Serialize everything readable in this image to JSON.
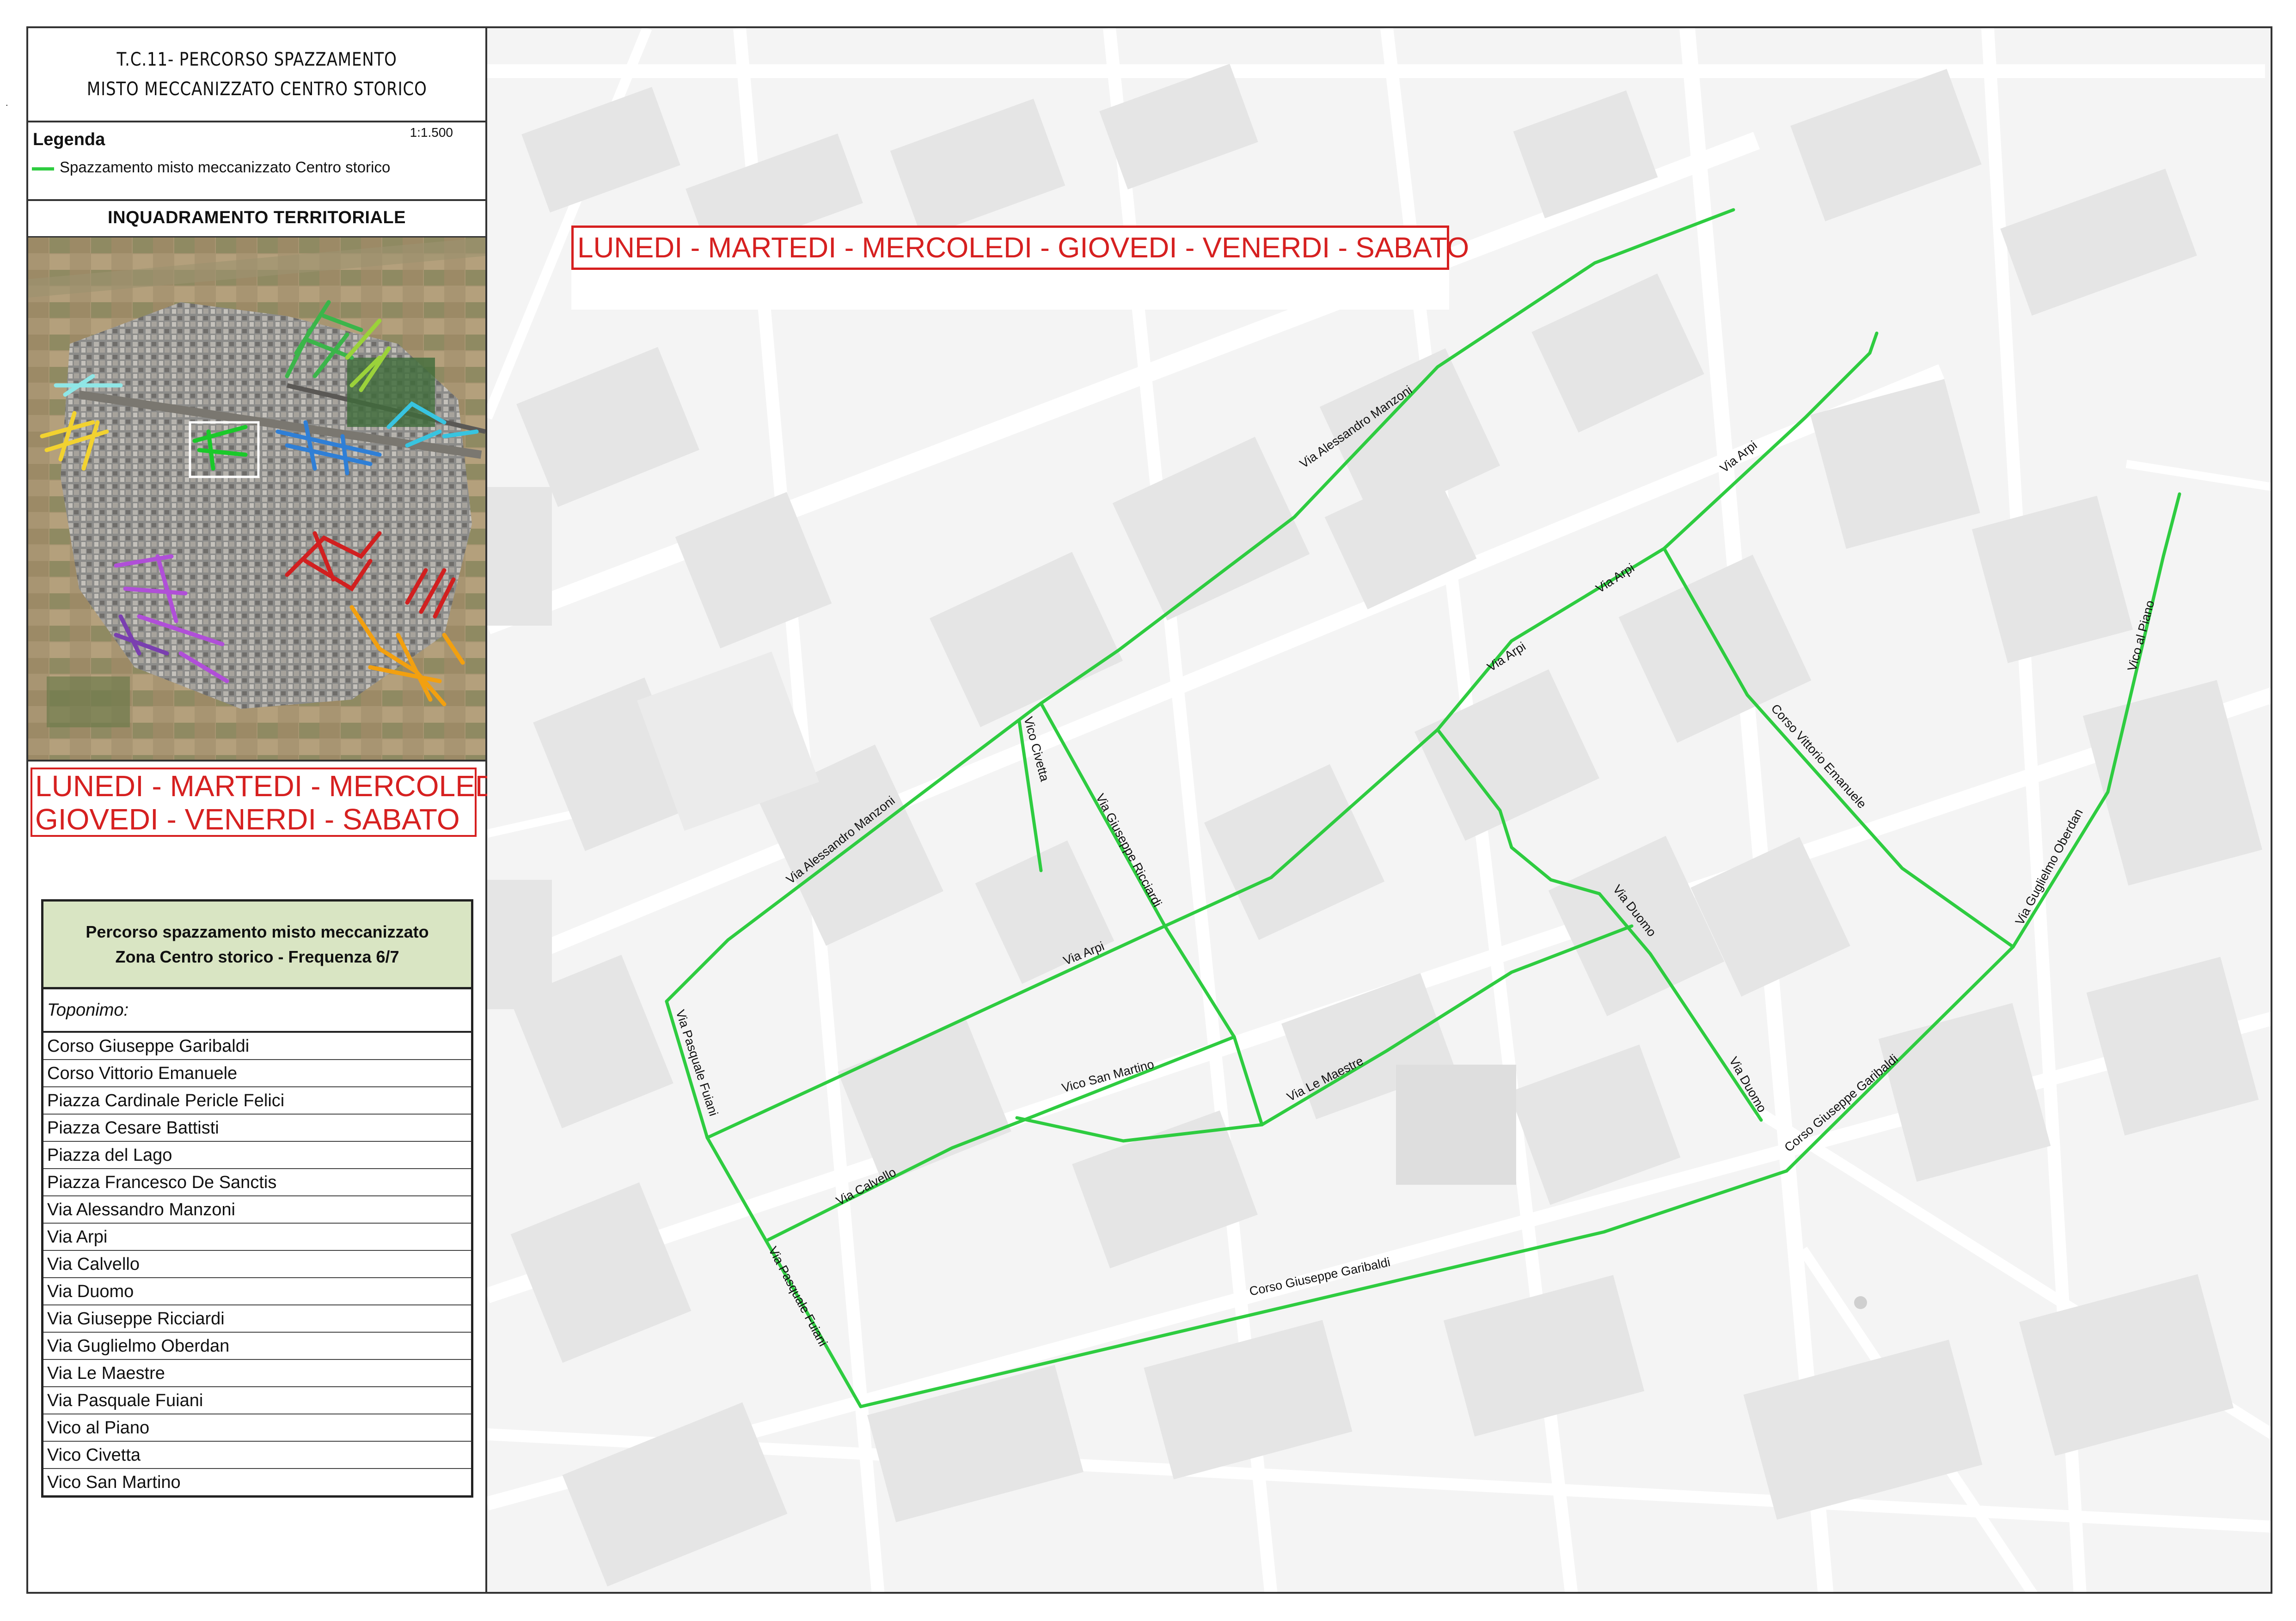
{
  "header": {
    "title_line1": "T.C.11- PERCORSO SPAZZAMENTO",
    "title_line2": "MISTO MECCANIZZATO CENTRO STORICO"
  },
  "legend": {
    "title": "Legenda",
    "scale": "1:1.500",
    "item_label": "Spazzamento misto meccanizzato Centro storico",
    "route_color": "#2ecc40"
  },
  "overview": {
    "title": "INQUADRAMENTO TERRITORIALE"
  },
  "days_left": {
    "line1": "LUNEDI - MARTEDI - MERCOLEDI",
    "line2": "GIOVEDI - VENERDI - SABATO"
  },
  "days_top": "LUNEDI - MARTEDI - MERCOLEDI - GIOVEDI - VENERDI - SABATO",
  "route_table": {
    "header_line1": "Percorso spazzamento misto meccanizzato",
    "header_line2": "Zona Centro storico - Frequenza 6/7",
    "toponimo_label": "Toponimo:",
    "streets": [
      "Corso Giuseppe Garibaldi",
      "Corso Vittorio Emanuele",
      "Piazza Cardinale Pericle Felici",
      "Piazza Cesare Battisti",
      "Piazza del Lago",
      "Piazza Francesco De Sanctis",
      "Via Alessandro Manzoni",
      "Via Arpi",
      "Via Calvello",
      "Via Duomo",
      "Via Giuseppe Ricciardi",
      "Via Guglielmo Oberdan",
      "Via Le Maestre",
      "Via Pasquale Fuiani",
      "Vico al Piano",
      "Vico Civetta",
      "Vico San Martino"
    ]
  },
  "map_labels": {
    "manzoni_upper": "Via Alessandro Manzoni",
    "manzoni_lower": "Via Alessandro Manzoni",
    "arpi_1": "Via Arpi",
    "arpi_2": "Via Arpi",
    "arpi_3": "Via Arpi",
    "arpi_4": "Via Arpi",
    "civetta": "Vico Civetta",
    "ricciardi": "Via Giuseppe Ricciardi",
    "vittorio": "Corso Vittorio Emanuele",
    "oberdan": "Via Guglielmo Oberdan",
    "al_piano": "Vico al Piano",
    "duomo_1": "Via Duomo",
    "duomo_2": "Via Duomo",
    "fuiani_1": "Via Pasquale Fuiani",
    "fuiani_2": "Via Pasquale Fuiani",
    "san_martino": "Vico San Martino",
    "maestre": "Via Le Maestre",
    "calvello": "Via Calvello",
    "garibaldi_1": "Corso Giuseppe Garibaldi",
    "garibaldi_2": "Corso Giuseppe Garibaldi"
  },
  "colors": {
    "route": "#2ecc40",
    "days_text": "#d62020",
    "table_header_bg": "#d9e5c3"
  }
}
